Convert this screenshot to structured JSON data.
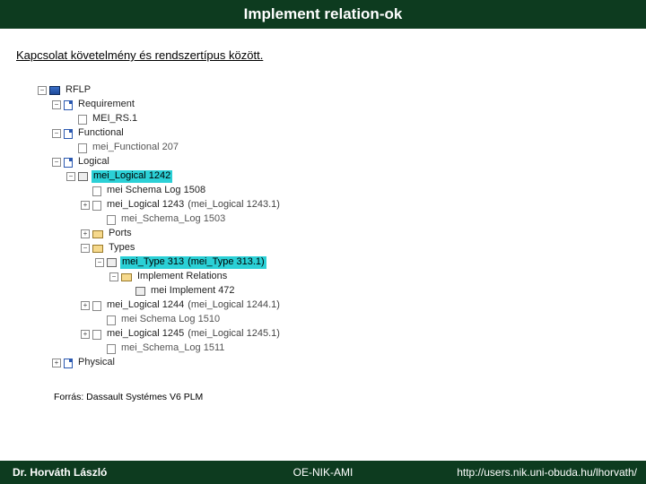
{
  "title": "Implement relation-ok",
  "subtitle": "Kapcsolat követelmény és rendszertípus között.",
  "tree": {
    "root": "RFLP",
    "requirement": "Requirement",
    "mei_rs": "MEI_RS.1",
    "functional": "Functional",
    "mei_func": "mei_Functional 207",
    "logical": "Logical",
    "sel_logical": "mei_Logical 1242",
    "schema_1508": "mei Schema Log 1508",
    "logical_1243": "mei_Logical 1243",
    "logical_1243_ext": "(mei_Logical 1243.1)",
    "schema_1503": "mei_Schema_Log 1503",
    "ports": "Ports",
    "types": "Types",
    "sel_type": "mei_Type 313",
    "sel_type_ext": "(mei_Type 313.1)",
    "impl_rel": "Implement Relations",
    "mei_impl": "mei Implement 472",
    "logical_1244": "mei_Logical 1244",
    "logical_1244_ext": "(mei_Logical 1244.1)",
    "schema_1510": "mei Schema Log 1510",
    "logical_1245": "mei_Logical 1245",
    "logical_1245_ext": "(mei_Logical 1245.1)",
    "schema_1511": "mei_Schema_Log 1511",
    "physical": "Physical"
  },
  "source": "Forrás: Dassault Systémes V6 PLM",
  "footer": {
    "author": "Dr. Horváth László",
    "inst": "OE-NIK-AMI",
    "url": "http://users.nik.uni-obuda.hu/lhorvath/"
  }
}
